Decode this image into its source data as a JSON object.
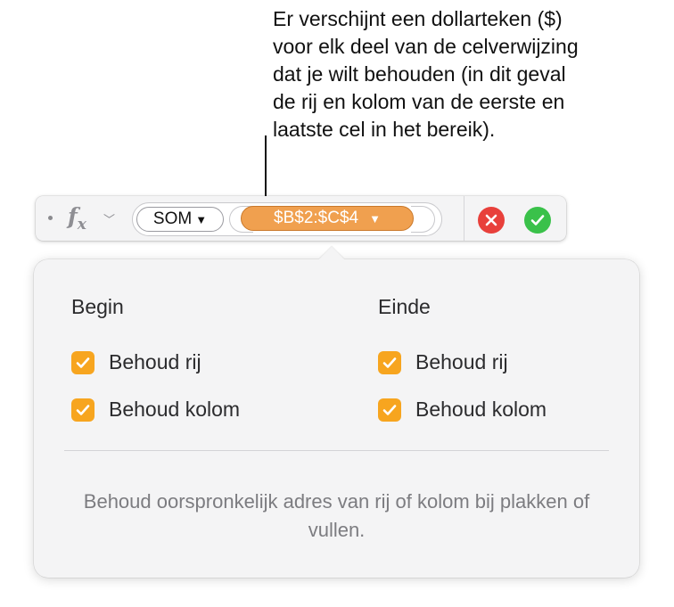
{
  "callout": {
    "text": "Er verschijnt een dollarteken ($)\nvoor elk deel van de celverwijzing\ndat je wilt behouden (in dit geval\nde rij en kolom van de eerste en\nlaatste cel in het bereik)."
  },
  "formula_bar": {
    "fx_icon": "function-icon",
    "function_name": "SOM",
    "function_arrow": "▼",
    "reference": "$B$2:$C$4",
    "reference_arrow": "▼",
    "reference_color": "#f0a04f",
    "cancel_color": "#e8403b",
    "accept_color": "#3ac14a"
  },
  "popover": {
    "begin": {
      "title": "Begin",
      "options": [
        {
          "label": "Behoud rij",
          "checked": true
        },
        {
          "label": "Behoud kolom",
          "checked": true
        }
      ]
    },
    "end": {
      "title": "Einde",
      "options": [
        {
          "label": "Behoud rij",
          "checked": true
        },
        {
          "label": "Behoud kolom",
          "checked": true
        }
      ]
    },
    "help_text": "Behoud oorspronkelijk adres van rij of kolom bij plakken of vullen.",
    "checkbox_color": "#f7a51f"
  }
}
